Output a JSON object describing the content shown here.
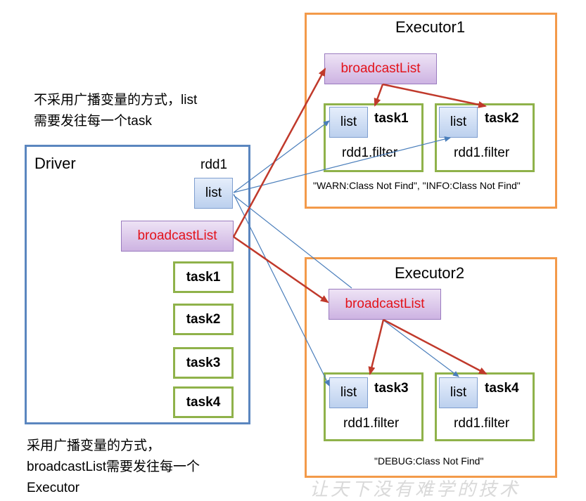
{
  "captions": {
    "top_line1": "不采用广播变量的方式，list",
    "top_line2": "需要发往每一个task",
    "bottom_line1": "采用广播变量的方式，",
    "bottom_line2": "broadcastList需要发往每一个",
    "bottom_line3": "Executor"
  },
  "driver": {
    "title": "Driver",
    "rdd_label": "rdd1",
    "list_label": "list",
    "broadcast_label": "broadcastList",
    "tasks": [
      "task1",
      "task2",
      "task3",
      "task4"
    ]
  },
  "executor1": {
    "title": "Executor1",
    "broadcast_label": "broadcastList",
    "tasks": [
      {
        "list": "list",
        "name": "task1",
        "filter": "rdd1.filter"
      },
      {
        "list": "list",
        "name": "task2",
        "filter": "rdd1.filter"
      }
    ],
    "note": "\"WARN:Class Not Find\", \"INFO:Class Not Find\""
  },
  "executor2": {
    "title": "Executor2",
    "broadcast_label": "broadcastList",
    "tasks": [
      {
        "list": "list",
        "name": "task3",
        "filter": "rdd1.filter"
      },
      {
        "list": "list",
        "name": "task4",
        "filter": "rdd1.filter"
      }
    ],
    "note": "\"DEBUG:Class Not Find\""
  },
  "watermark": "让天下没有难学的技术",
  "colors": {
    "driver_border": "#5b86bf",
    "executor_border": "#f39a4a",
    "task_border": "#8fb24a",
    "broadcast_arrow": "#c0392b",
    "list_arrow": "#4a7ebb",
    "broadcast_text": "#e3131b"
  }
}
